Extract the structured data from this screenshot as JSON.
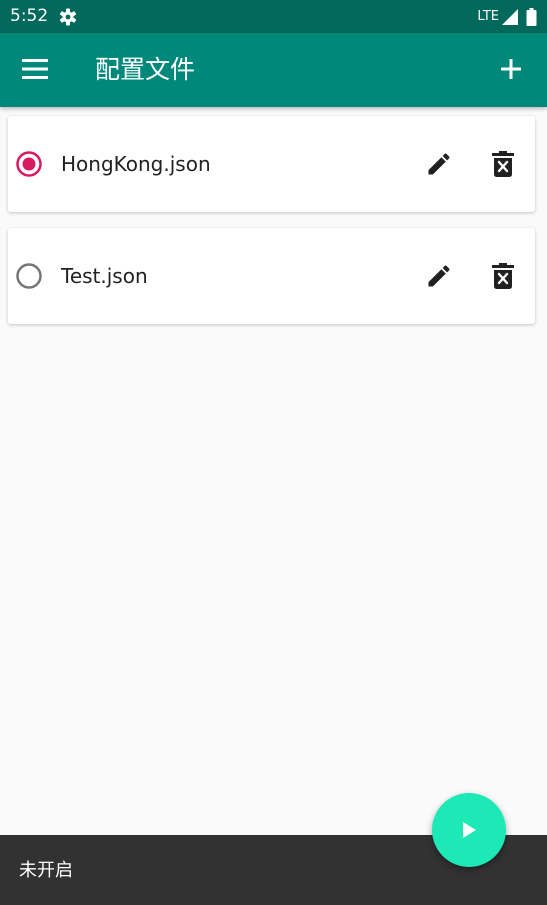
{
  "status_bar": {
    "time": "5:52",
    "network": "LTE",
    "icons": [
      "gear-icon",
      "signal-icon",
      "battery-icon"
    ]
  },
  "app_bar": {
    "title": "配置文件",
    "icons": [
      "menu-icon",
      "add-icon"
    ]
  },
  "profiles": [
    {
      "name": "HongKong.json",
      "selected": true
    },
    {
      "name": "Test.json",
      "selected": false
    }
  ],
  "profile_actions": [
    "edit-icon",
    "delete-icon"
  ],
  "bottom_bar": {
    "status": "未开启"
  },
  "fab": {
    "icon": "play-icon"
  },
  "colors": {
    "status_bar": "#00695c",
    "app_bar": "#00897b",
    "radio_selected": "#d81b60",
    "radio_unselected": "#757575",
    "fab": "#1de9b6",
    "bottom_bar": "#323232",
    "background": "#fafafa"
  }
}
